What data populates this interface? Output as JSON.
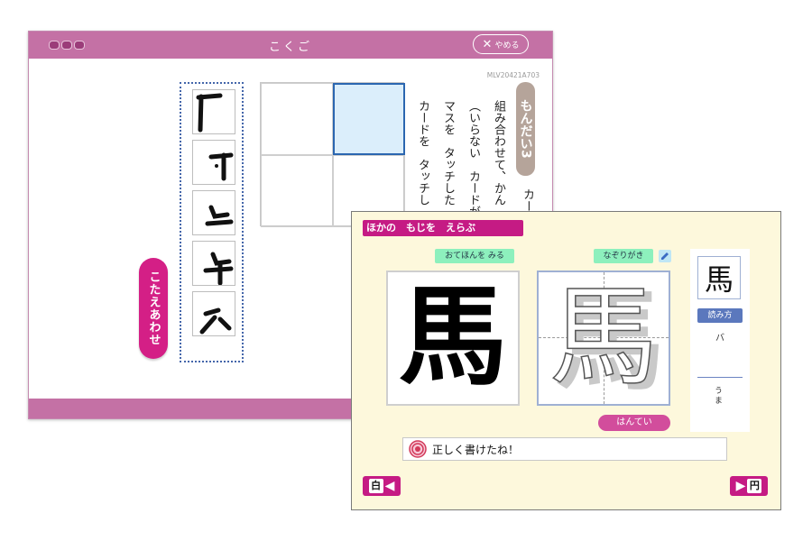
{
  "back_window": {
    "title": "こくご",
    "quit_label": "やめる",
    "code": "MLV20421A703",
    "mondai_label": "もんだい3",
    "question_lines": [
      "カード",
      "組み合わせて、かん",
      "（いらない　カードが",
      "マスを　タッチした",
      "カードを　タッチし"
    ],
    "answer_button": "こたえあわせ",
    "cards_count": 5
  },
  "front_window": {
    "header": "ほかの　もじを　えらぶ",
    "model_label": "おてほんを みる",
    "trace_label": "なぞりがき",
    "character": "馬",
    "judge_button": "はんてい",
    "yomi_label": "読み方",
    "on_reading": "バ",
    "kun_reading": "うま",
    "message": "正しく書けたね！",
    "prev_kanji": "白",
    "next_kanji": "円"
  },
  "colors": {
    "magenta": "#c51b84",
    "pink_bar": "#c471a5",
    "green": "#8df0bd",
    "blue": "#5b78bd"
  }
}
